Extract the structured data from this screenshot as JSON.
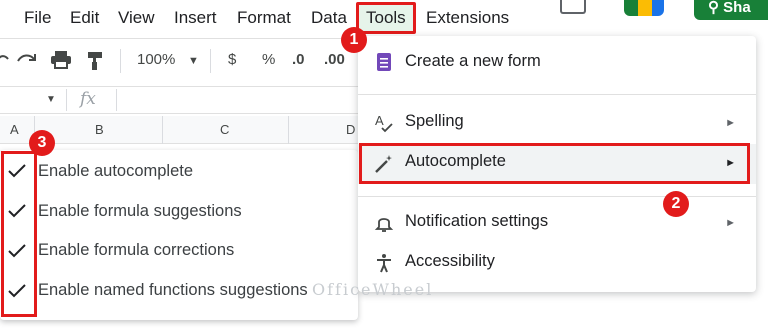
{
  "menubar": {
    "items": [
      "File",
      "Edit",
      "View",
      "Insert",
      "Format",
      "Data",
      "Tools",
      "Extensions"
    ]
  },
  "toolbar": {
    "zoom": "100%",
    "currency": "$",
    "percent": "%",
    "decrease_decimal": ".0",
    "increase_decimal": ".00"
  },
  "formula_bar": {
    "fx": "fx"
  },
  "columns": [
    "A",
    "B",
    "C",
    "D"
  ],
  "share_label": "Sha",
  "tools_menu": {
    "create_form": "Create a new form",
    "spelling": "Spelling",
    "autocomplete": "Autocomplete",
    "notifications": "Notification settings",
    "accessibility": "Accessibility"
  },
  "autocomplete_submenu": [
    "Enable autocomplete",
    "Enable formula suggestions",
    "Enable formula corrections",
    "Enable named functions suggestions"
  ],
  "badges": [
    "1",
    "2",
    "3"
  ],
  "watermark": "OfficeWheel",
  "colors": {
    "highlight": "#e21b1b",
    "share": "#188038",
    "form_icon": "#7248b9"
  }
}
